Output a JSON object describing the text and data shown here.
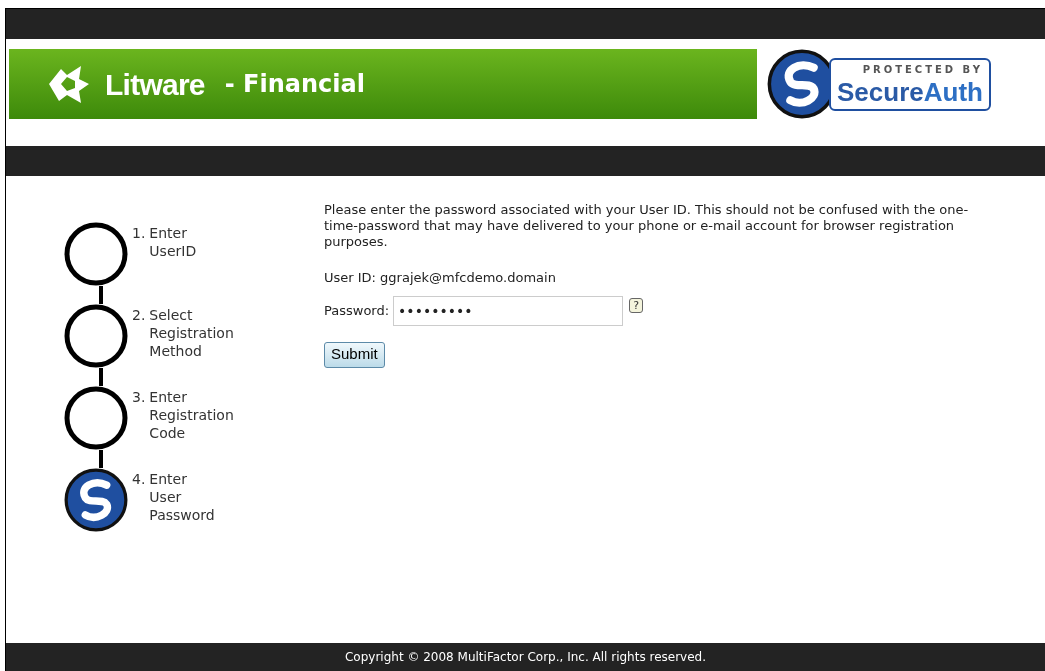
{
  "header": {
    "brand": "Litware",
    "subtitle": "- Financial",
    "badge": {
      "caption": "PROTECTED BY",
      "name_first": "Secure",
      "name_second": "Auth"
    }
  },
  "steps": [
    {
      "number": "1.",
      "lines": [
        "Enter",
        "UserID"
      ],
      "selected": false
    },
    {
      "number": "2.",
      "lines": [
        "Select",
        "Registration",
        "Method"
      ],
      "selected": false
    },
    {
      "number": "3.",
      "lines": [
        "Enter",
        "Registration",
        "Code"
      ],
      "selected": false
    },
    {
      "number": "4.",
      "lines": [
        "Enter",
        "User",
        "Password"
      ],
      "selected": true
    }
  ],
  "form": {
    "instructions": "Please enter the password associated with your User ID. This should not be confused with the one-time-password that may have delivered to your phone or e-mail account for browser registration purposes.",
    "user_id": "User ID: ggrajek@mfcdemo.domain",
    "password_label": "Password:",
    "password_value": "•••••••••",
    "help": "?",
    "submit": "Submit"
  },
  "footer": "Copyright © 2008 MultiFactor Corp., Inc. All rights reserved."
}
